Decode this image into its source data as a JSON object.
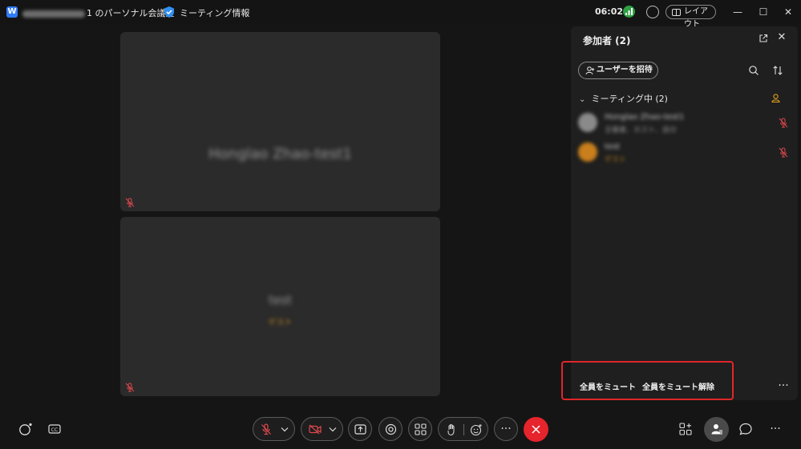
{
  "titlebar": {
    "meeting_room_suffix": "1 のパーソナル会議室",
    "meeting_info": "ミーティング情報",
    "time": "06:02",
    "layout_label": "レイアウト"
  },
  "tiles": [
    {
      "name": "Honglao Zhao-test1"
    },
    {
      "name": "test",
      "subtitle": "ゲスト"
    }
  ],
  "panel": {
    "title": "参加者 (2)",
    "invite_label": "ユーザーを招待",
    "section_label": "ミーティング中 (2)",
    "participants": [
      {
        "name": "Honglao Zhao-test1",
        "sub": "主催者、ホスト、自分"
      },
      {
        "name": "test",
        "sub": "ゲスト"
      }
    ],
    "mute_all": "全員をミュート",
    "unmute_all": "全員をミュート解除",
    "more": "···"
  },
  "toolbar": {
    "more": "···"
  },
  "colors": {
    "end_call": "#e5242c",
    "muted_red": "#e0484e",
    "highlight_box": "#e0262b",
    "host_badge": "#e0a020"
  }
}
